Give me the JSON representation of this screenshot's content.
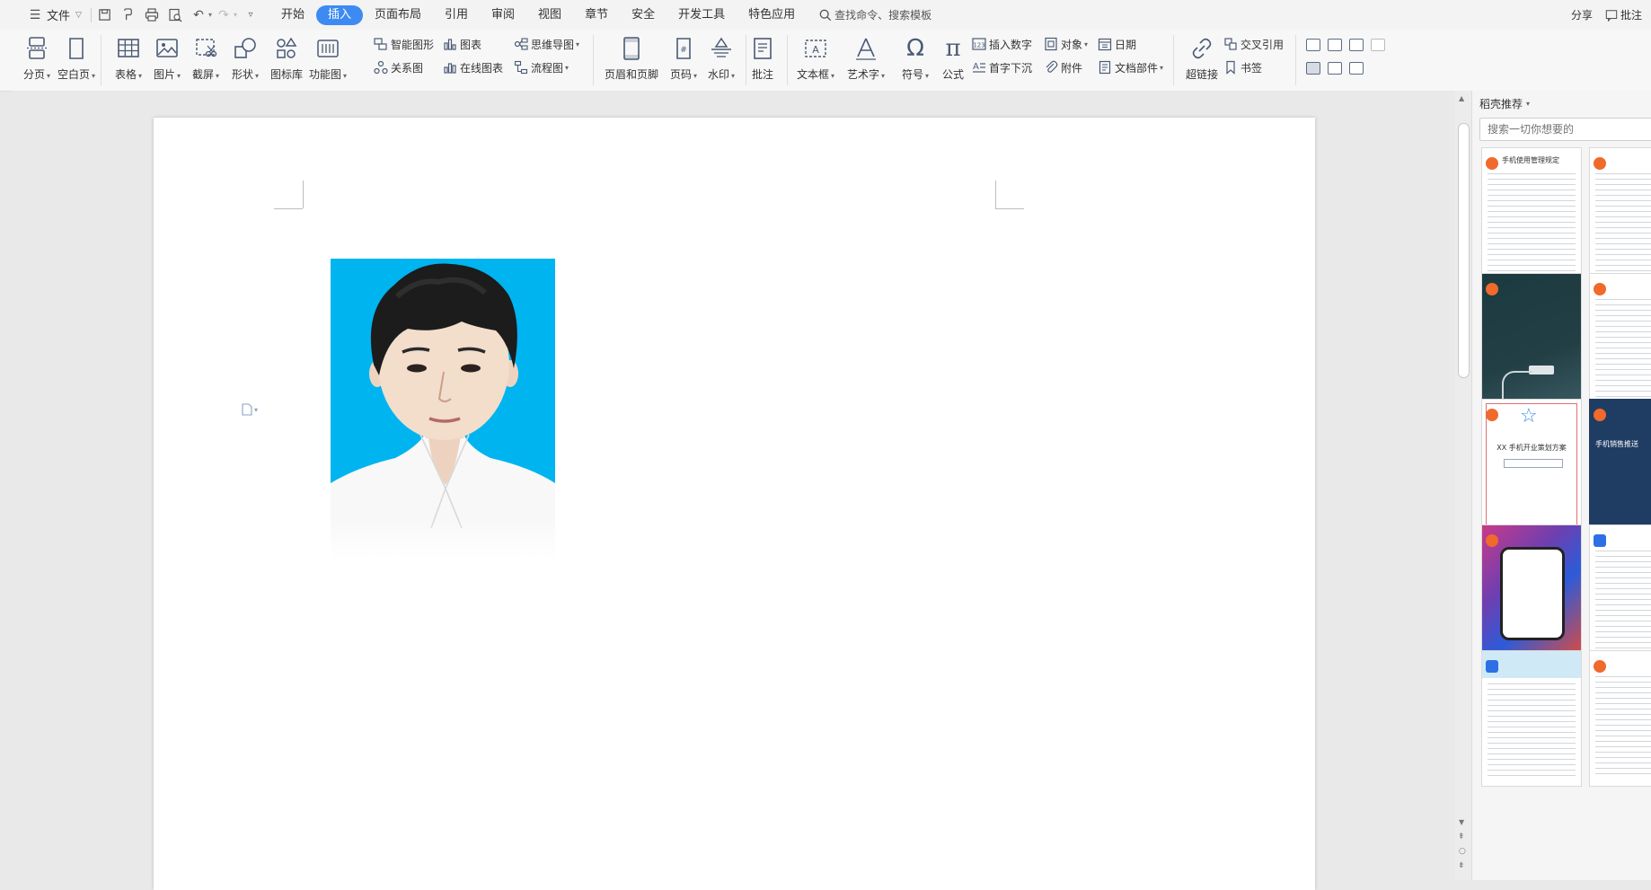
{
  "menubar": {
    "file_label": "文件",
    "tabs": [
      "开始",
      "插入",
      "页面布局",
      "引用",
      "审阅",
      "视图",
      "章节",
      "安全",
      "开发工具",
      "特色应用"
    ],
    "active_tab": "插入",
    "search_label": "查找命令、搜索模板",
    "share_label": "分享",
    "comment_label": "批注"
  },
  "ribbon": {
    "page_break": "分页",
    "blank_page": "空白页",
    "table": "表格",
    "picture": "图片",
    "screenshot": "截屏",
    "shape": "形状",
    "icon_lib": "图标库",
    "func_chart": "功能图",
    "smart_art": "智能图形",
    "chart": "图表",
    "mind_map": "思维导图",
    "relation_chart": "关系图",
    "online_chart": "在线图表",
    "flow_chart": "流程图",
    "header_footer": "页眉和页脚",
    "page_number": "页码",
    "watermark": "水印",
    "comment": "批注",
    "text_box": "文本框",
    "word_art": "艺术字",
    "symbol": "符号",
    "formula": "公式",
    "insert_number": "插入数字",
    "object": "对象",
    "date": "日期",
    "drop_cap": "首字下沉",
    "attachment": "附件",
    "doc_parts": "文档部件",
    "hyperlink": "超链接",
    "cross_ref": "交叉引用",
    "bookmark": "书签"
  },
  "right_panel": {
    "title": "稻壳推荐",
    "search_placeholder": "搜索一切你想要的",
    "template_1_title": "手机使用管理规定",
    "template_5_title": "XX 手机开业策划方案",
    "template_6_title": "手机销售推送"
  },
  "colors": {
    "accent": "#3d8bf2",
    "photo_bg": "#00b4f0",
    "orange_badge": "#f06a2b"
  }
}
